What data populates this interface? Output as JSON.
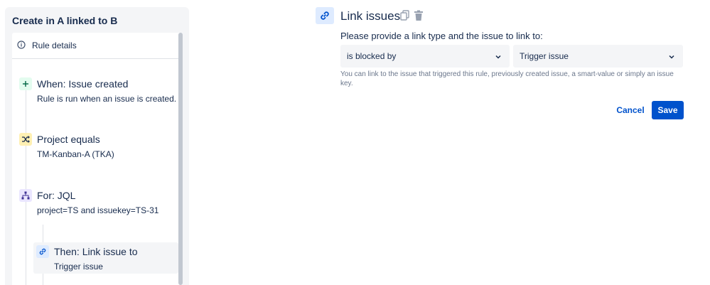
{
  "panel": {
    "title": "Create in A linked to B",
    "rule_details_label": "Rule details",
    "steps": [
      {
        "title": "When: Issue created",
        "subtitle": "Rule is run when an issue is created.",
        "icon": "plus-icon",
        "color": "#e3fcef",
        "icon_color": "#006644"
      },
      {
        "title": "Project equals",
        "subtitle": "TM-Kanban-A (TKA)",
        "icon": "shuffle-icon",
        "color": "#fff0b3",
        "icon_color": "#172b4d"
      },
      {
        "title": "For: JQL",
        "subtitle": "project=TS and issuekey=TS-31",
        "icon": "branch-icon",
        "color": "#eae6ff",
        "icon_color": "#403294"
      },
      {
        "title": "Then: Link issue to",
        "subtitle": "Trigger issue",
        "icon": "link-icon",
        "color": "#deebff",
        "icon_color": "#0052cc"
      }
    ]
  },
  "config": {
    "title": "Link issues",
    "prompt": "Please provide a link type and the issue to link to:",
    "link_type_value": "is blocked by",
    "issue_value": "Trigger issue",
    "help_text": "You can link to the issue that triggered this rule, previously created issue, a smart-value or simply an issue key.",
    "cancel_label": "Cancel",
    "save_label": "Save"
  },
  "colors": {
    "accent": "#0052cc",
    "panel_bg": "#f4f5f7"
  }
}
